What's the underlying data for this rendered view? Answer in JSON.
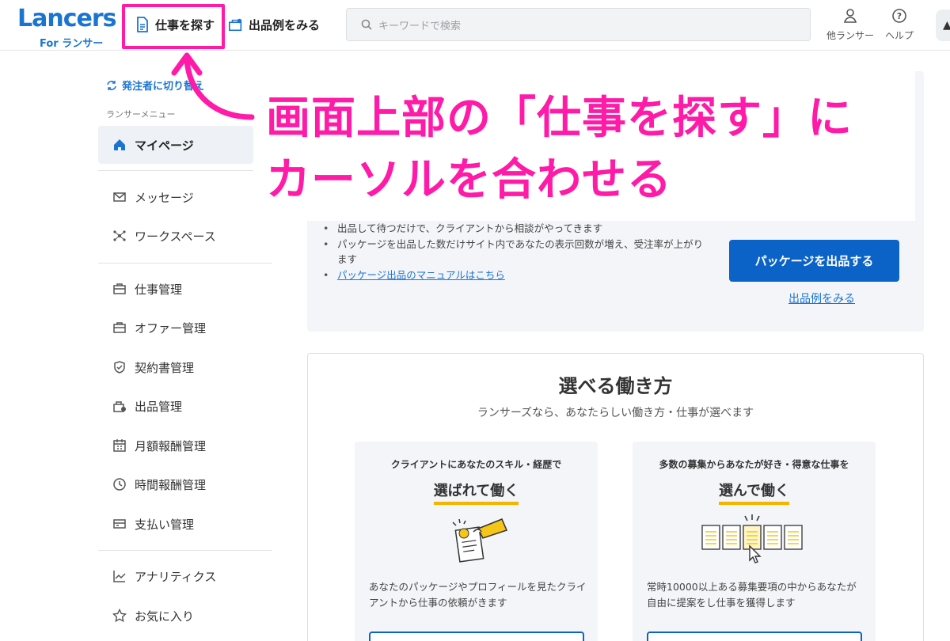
{
  "header": {
    "logo_text": "Lancers",
    "logo_sub": "For ランサー",
    "nav_find": "仕事を探す",
    "nav_example": "出品例をみる",
    "search_placeholder": "キーワードで検索",
    "other_lancer": "他ランサー",
    "help": "ヘルプ"
  },
  "sidebar": {
    "switch_label": "発注者に切り替え",
    "menu_caption": "ランサーメニュー",
    "mypage": "マイページ",
    "items": [
      {
        "label": "メッセージ",
        "icon": "mail-icon"
      },
      {
        "label": "ワークスペース",
        "icon": "workspace-icon"
      },
      {
        "label": "仕事管理",
        "icon": "briefcase-icon"
      },
      {
        "label": "オファー管理",
        "icon": "offer-icon"
      },
      {
        "label": "契約書管理",
        "icon": "shield-icon"
      },
      {
        "label": "出品管理",
        "icon": "store-icon"
      },
      {
        "label": "月額報酬管理",
        "icon": "calendar-icon"
      },
      {
        "label": "時間報酬管理",
        "icon": "clock-icon"
      },
      {
        "label": "支払い管理",
        "icon": "card-icon"
      },
      {
        "label": "アナリティクス",
        "icon": "chart-icon"
      },
      {
        "label": "お気に入り",
        "icon": "star-icon"
      }
    ]
  },
  "package": {
    "bullets": [
      "出品して待つだけで、クライアントから相談がやってきます",
      "パッケージを出品した数だけサイト内であなたの表示回数が増え、受注率が上がります"
    ],
    "manual_link": "パッケージ出品のマニュアルはこちら",
    "button": "パッケージを出品する",
    "example_link": "出品例をみる"
  },
  "choose": {
    "title": "選べる働き方",
    "subtitle": "ランサーズなら、あなたらしい働き方・仕事が選べます",
    "cards": [
      {
        "lead": "クライアントにあなたのスキル・経歴で",
        "head": "選ばれて働く",
        "body": "あなたのパッケージやプロフィールを見たクライアントから仕事の依頼がきます"
      },
      {
        "lead": "多数の募集からあなたが好き・得意な仕事を",
        "head": "選んで働く",
        "body": "常時10000以上ある募集要項の中からあなたが自由に提案をし仕事を獲得します"
      }
    ]
  },
  "annotation": {
    "line1": "画面上部の「仕事を探す」に",
    "line2": "カーソルを合わせる"
  },
  "colors": {
    "accent": "#0c63c7",
    "annotation": "#ff1aa8",
    "underline": "#f5b400"
  }
}
